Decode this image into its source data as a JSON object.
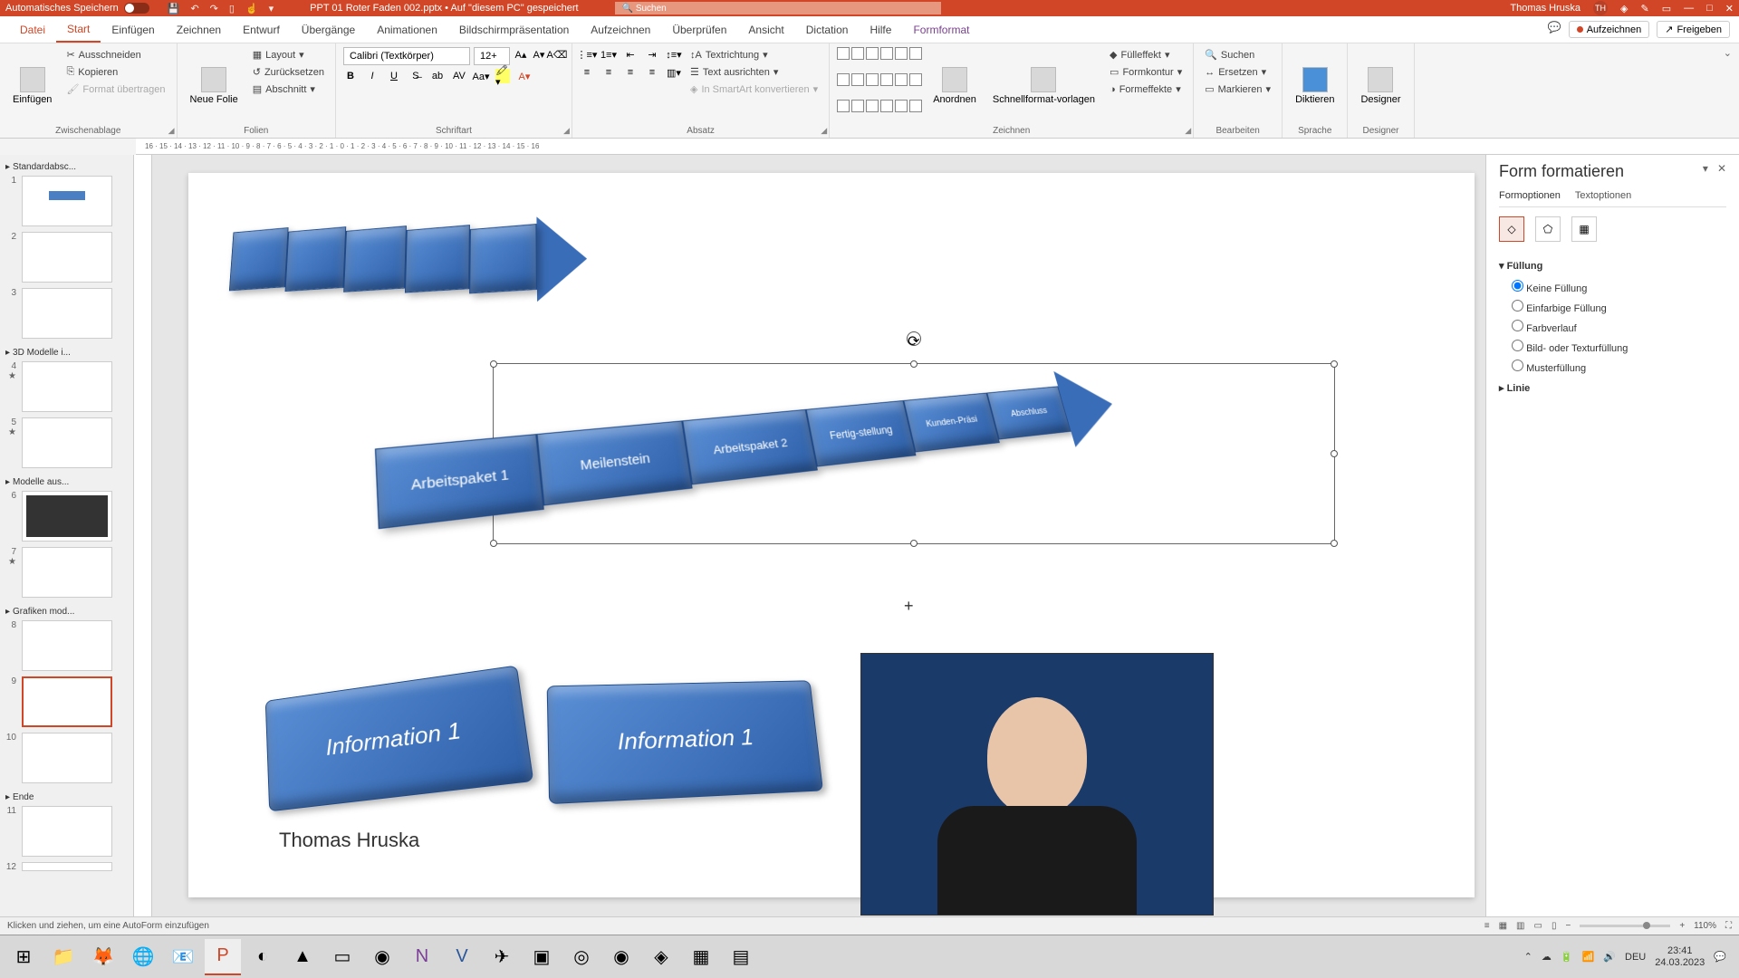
{
  "titlebar": {
    "autosave": "Automatisches Speichern",
    "doc": "PPT 01 Roter Faden 002.pptx • Auf \"diesem PC\" gespeichert",
    "search_placeholder": "Suchen",
    "user": "Thomas Hruska",
    "user_initials": "TH"
  },
  "tabs": {
    "file": "Datei",
    "start": "Start",
    "einfuegen": "Einfügen",
    "zeichnen": "Zeichnen",
    "entwurf": "Entwurf",
    "uebergaenge": "Übergänge",
    "animationen": "Animationen",
    "bildschirm": "Bildschirmpräsentation",
    "aufzeichnen_tab": "Aufzeichnen",
    "ueberpruefen": "Überprüfen",
    "ansicht": "Ansicht",
    "dictation": "Dictation",
    "hilfe": "Hilfe",
    "formformat": "Formformat",
    "aufzeichnen_btn": "Aufzeichnen",
    "freigeben": "Freigeben"
  },
  "ribbon": {
    "einfuegen": "Einfügen",
    "ausschneiden": "Ausschneiden",
    "kopieren": "Kopieren",
    "format_uebertragen": "Format übertragen",
    "zwischenablage": "Zwischenablage",
    "neue_folie": "Neue Folie",
    "layout": "Layout",
    "zuruecksetzen": "Zurücksetzen",
    "abschnitt": "Abschnitt",
    "folien": "Folien",
    "font_name": "Calibri (Textkörper)",
    "font_size": "12+",
    "schriftart": "Schriftart",
    "absatz": "Absatz",
    "textrichtung": "Textrichtung",
    "text_ausrichten": "Text ausrichten",
    "smartart": "In SmartArt konvertieren",
    "anordnen": "Anordnen",
    "schnellformat": "Schnellformat-vorlagen",
    "fuelleffekt": "Fülleffekt",
    "formkontur": "Formkontur",
    "formeffekte": "Formeffekte",
    "zeichnen": "Zeichnen",
    "suchen": "Suchen",
    "ersetzen": "Ersetzen",
    "markieren": "Markieren",
    "bearbeiten": "Bearbeiten",
    "diktieren": "Diktieren",
    "sprache": "Sprache",
    "designer": "Designer",
    "designer_grp": "Designer"
  },
  "sections": {
    "s1": "Standardabsc...",
    "s2": "3D Modelle i...",
    "s3": "Modelle aus...",
    "s4": "Grafiken mod...",
    "s5": "Ende"
  },
  "slide": {
    "arrow_labels": [
      "Arbeitspaket 1",
      "Meilenstein",
      "Arbeitspaket 2",
      "Fertig-stellung",
      "Kunden-Präsi",
      "Abschluss"
    ],
    "info1": "Information 1",
    "info2": "Information 1",
    "author": "Thomas Hruska"
  },
  "pane": {
    "title": "Form formatieren",
    "formoptionen": "Formoptionen",
    "textoptionen": "Textoptionen",
    "fuellung": "Füllung",
    "keine": "Keine Füllung",
    "einfarbige": "Einfarbige Füllung",
    "farbverlauf": "Farbverlauf",
    "bild": "Bild- oder Texturfüllung",
    "muster": "Musterfüllung",
    "linie": "Linie"
  },
  "status": {
    "msg": "Klicken und ziehen, um eine AutoForm einzufügen",
    "zoom": "110%"
  },
  "tray": {
    "lang": "DEU",
    "time": "23:41",
    "date": "24.03.2023"
  }
}
